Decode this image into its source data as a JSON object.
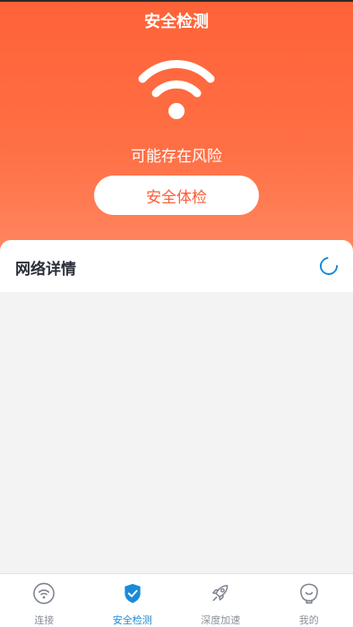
{
  "header": {
    "title": "安全检测"
  },
  "hero": {
    "status_text": "可能存在风险",
    "check_button_label": "安全体检"
  },
  "network_card": {
    "title": "网络详情"
  },
  "tabbar": {
    "tabs": [
      {
        "label": "连接",
        "icon": "wifi-circle-icon",
        "active": false
      },
      {
        "label": "安全检测",
        "icon": "shield-check-icon",
        "active": true
      },
      {
        "label": "深度加速",
        "icon": "rocket-icon",
        "active": false
      },
      {
        "label": "我的",
        "icon": "profile-icon",
        "active": false
      }
    ]
  },
  "colors": {
    "accent": "#ff6238",
    "tab_active": "#1a8ad8",
    "tab_inactive": "#8a8f99"
  }
}
